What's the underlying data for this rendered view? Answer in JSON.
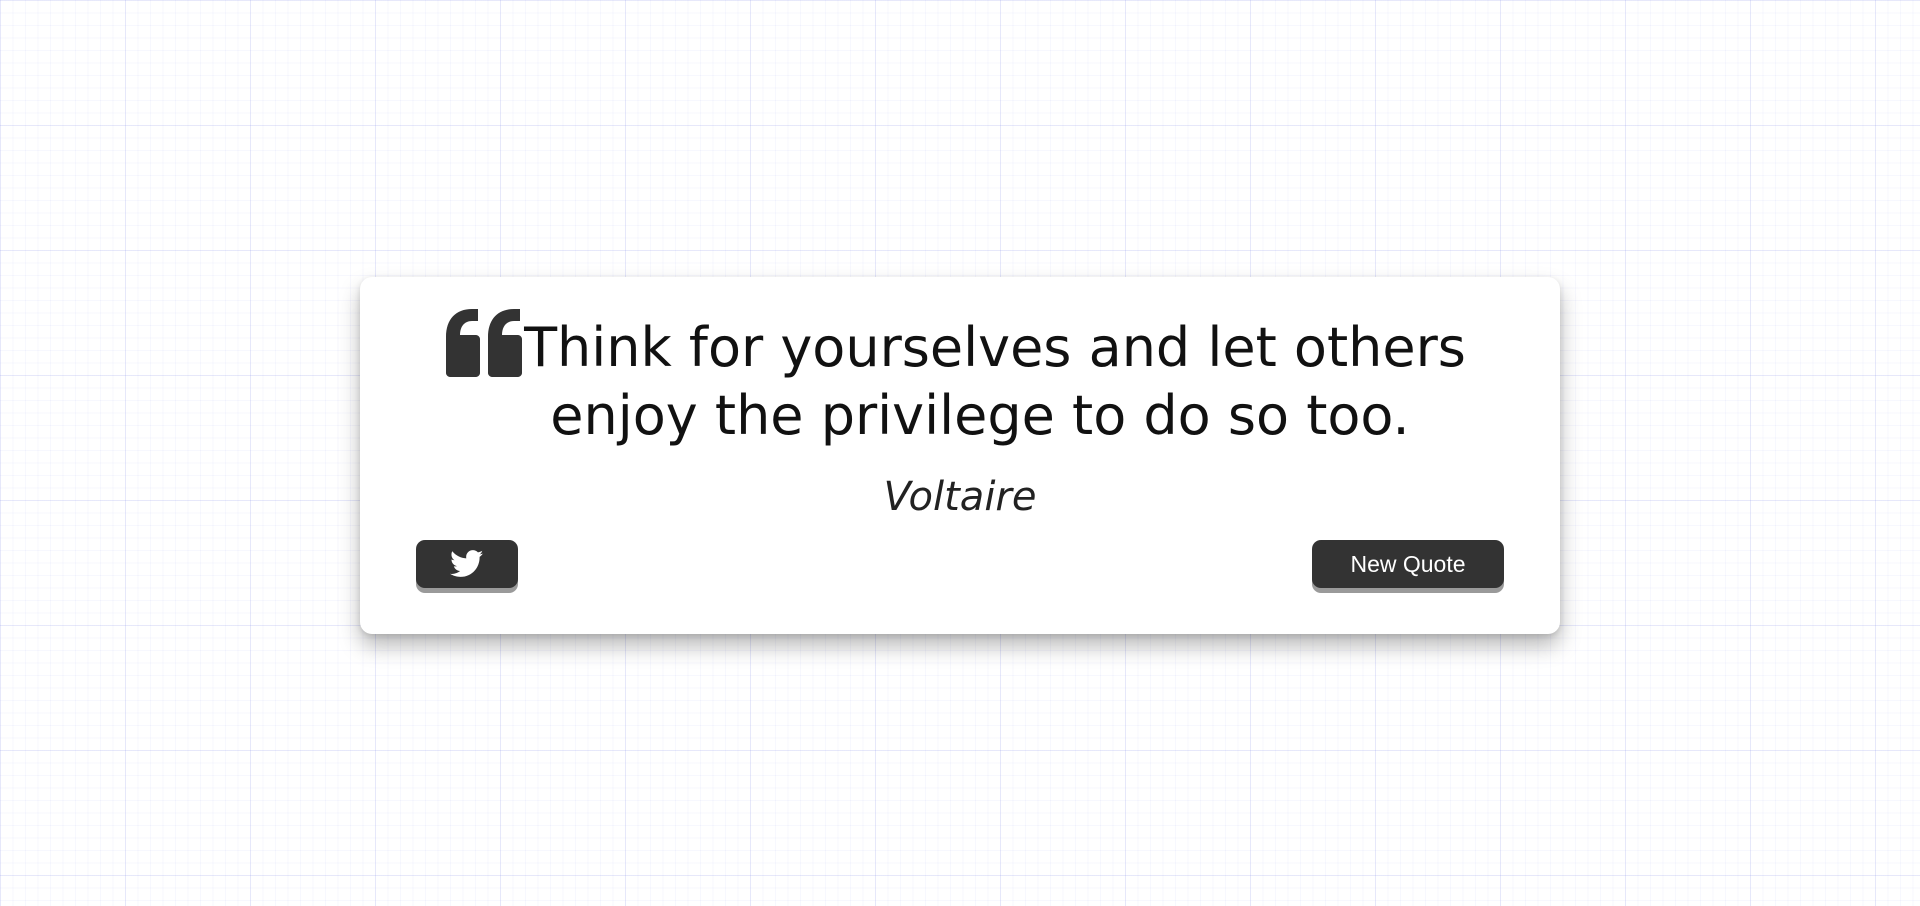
{
  "quote": {
    "text": "Think for yourselves and let others enjoy the privilege to do so too.",
    "author": "Voltaire"
  },
  "buttons": {
    "tweet_icon": "twitter-icon",
    "new_quote_label": "New Quote"
  },
  "colors": {
    "button_bg": "#333333",
    "button_shadow": "#9a9a9a",
    "text": "#111111",
    "card_bg": "#ffffff"
  }
}
